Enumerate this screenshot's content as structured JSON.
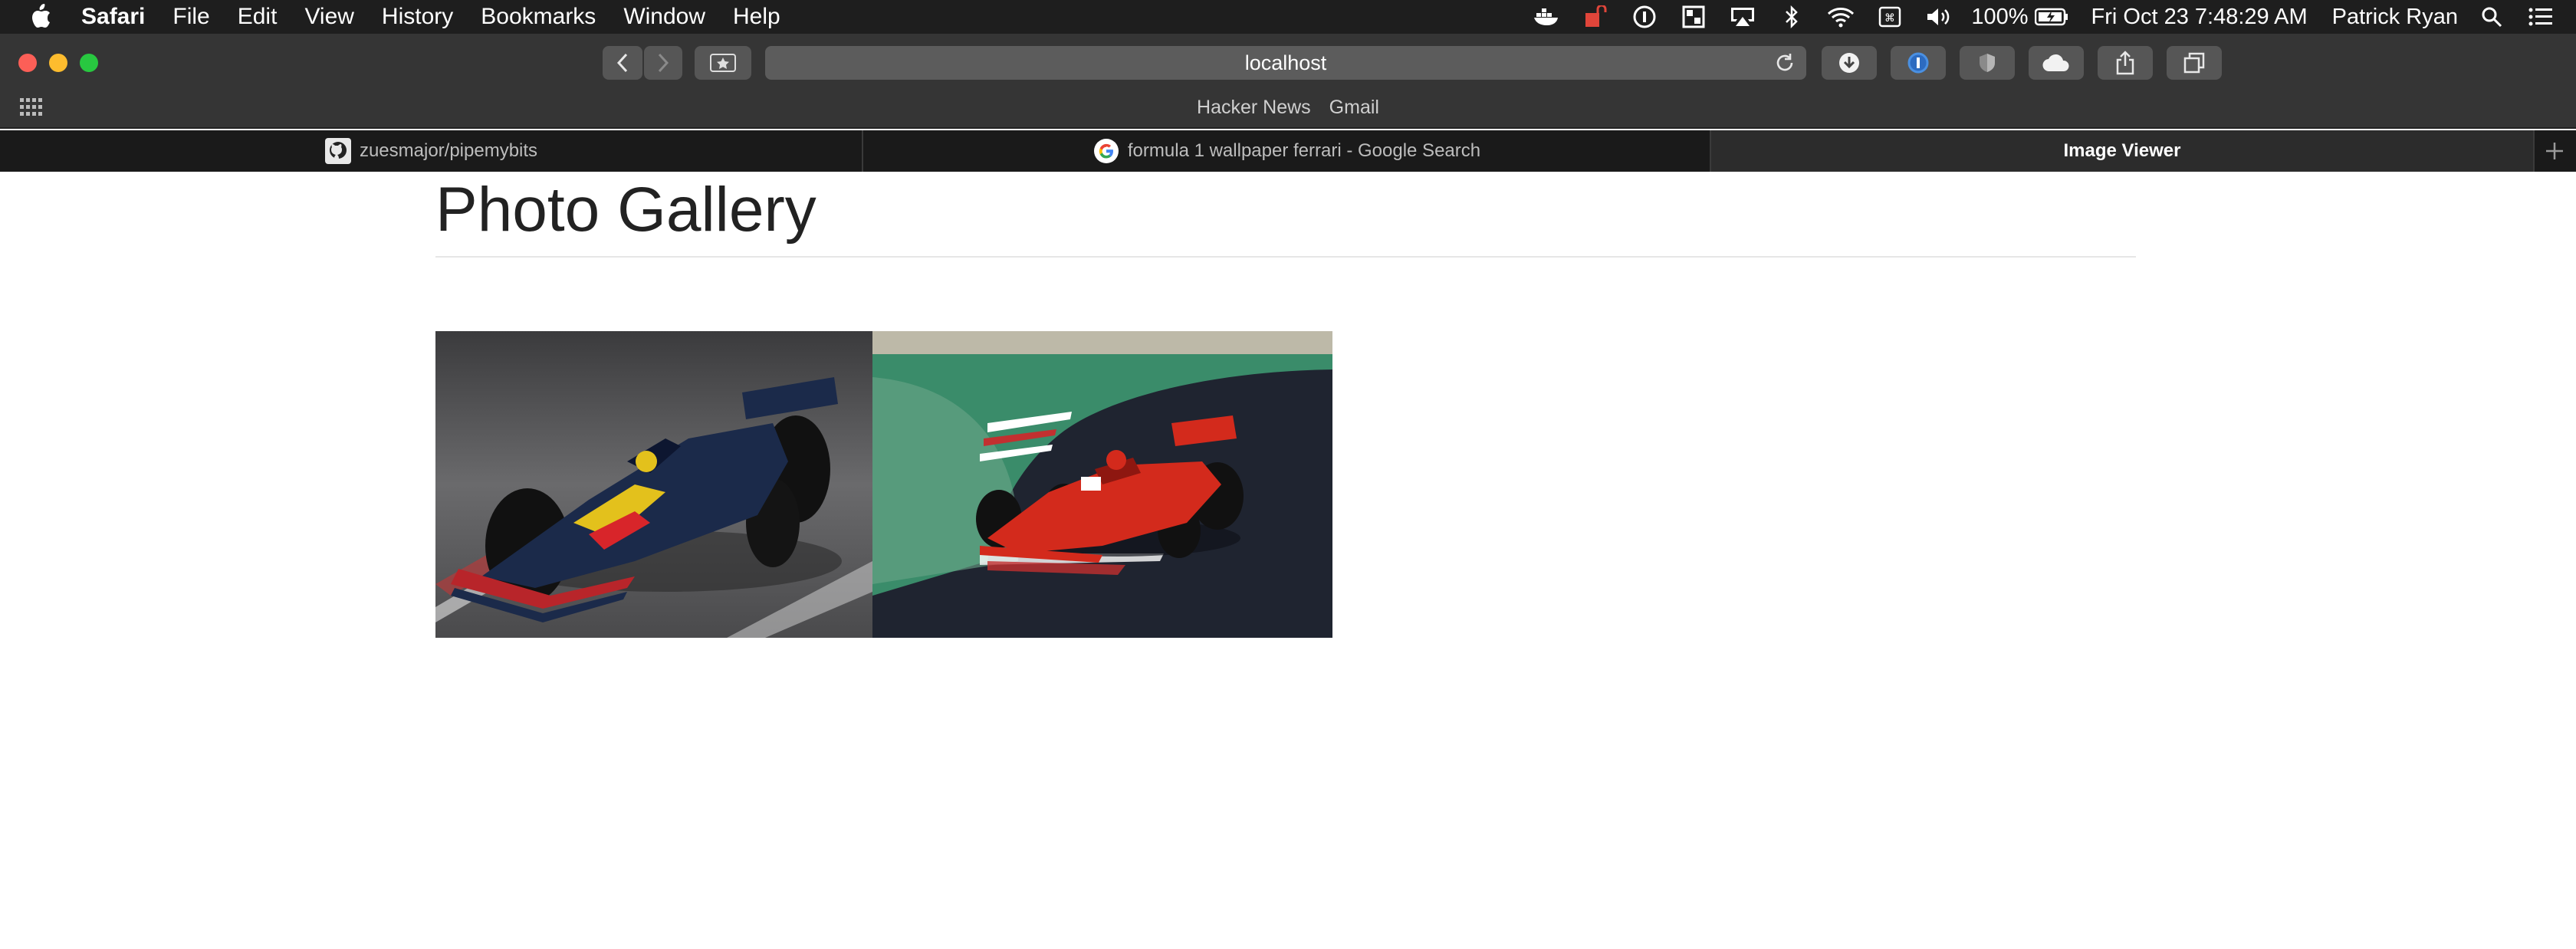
{
  "menubar": {
    "app": "Safari",
    "items": [
      "File",
      "Edit",
      "View",
      "History",
      "Bookmarks",
      "Window",
      "Help"
    ],
    "battery": "100%",
    "datetime": "Fri Oct 23  7:48:29 AM",
    "user": "Patrick Ryan"
  },
  "toolbar": {
    "url": "localhost",
    "favorites": [
      "Hacker News",
      "Gmail"
    ]
  },
  "tabs": [
    {
      "label": "zuesmajor/pipemybits",
      "icon": "github-icon"
    },
    {
      "label": "formula 1 wallpaper ferrari - Google Search",
      "icon": "google-icon"
    },
    {
      "label": "Image Viewer",
      "active": true
    }
  ],
  "page": {
    "title": "Photo Gallery",
    "photos": [
      {
        "subject": "red-bull-f1-car",
        "colors": {
          "bg": "#5a5a5c",
          "car": "#1b2a4a"
        }
      },
      {
        "subject": "ferrari-f1-car",
        "colors": {
          "bg": "#1f2430",
          "car": "#d32a1c"
        }
      }
    ]
  }
}
